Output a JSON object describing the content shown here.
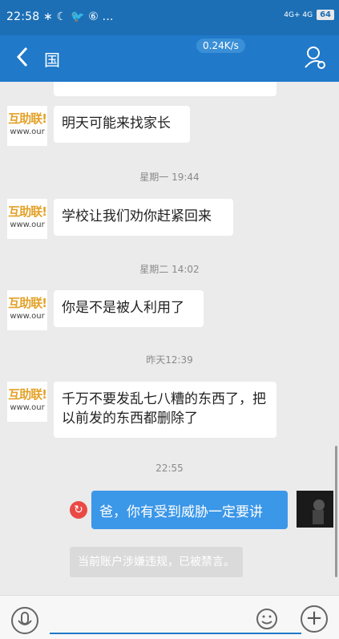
{
  "status_bar": {
    "time": "22:58",
    "indicators": "∗ ☾ 🐦 ⑥ ...",
    "signal": "4G+ 4G",
    "battery": "64"
  },
  "nav": {
    "back_icon": "chevron-left",
    "title": "国",
    "network_speed": "0.24K/s",
    "contact_icon": "contact-settings"
  },
  "logo": {
    "line1": "互助联!",
    "line2": "www.our"
  },
  "messages": [
    {
      "type": "incoming",
      "text": "明天可能来找家长"
    },
    {
      "type": "time",
      "text": "星期一 19:44"
    },
    {
      "type": "incoming",
      "text": "学校让我们劝你赶紧回来"
    },
    {
      "type": "time",
      "text": "星期二 14:02"
    },
    {
      "type": "incoming",
      "text": "你是不是被人利用了"
    },
    {
      "type": "time",
      "text": "昨天12:39"
    },
    {
      "type": "incoming",
      "text": "千万不要发乱七八糟的东西了，把以前发的东西都删除了"
    },
    {
      "type": "time",
      "text": "22:55"
    },
    {
      "type": "outgoing",
      "text": "爸，你有受到威胁一定要讲"
    },
    {
      "type": "system",
      "text": "当前账户涉嫌违规，已被禁言。"
    }
  ],
  "composer": {
    "value": "",
    "placeholder": ""
  },
  "colors": {
    "header": "#2079c9",
    "status": "#1c6fb5",
    "outgoing_bubble": "#3b97e8",
    "error": "#e94a44"
  }
}
